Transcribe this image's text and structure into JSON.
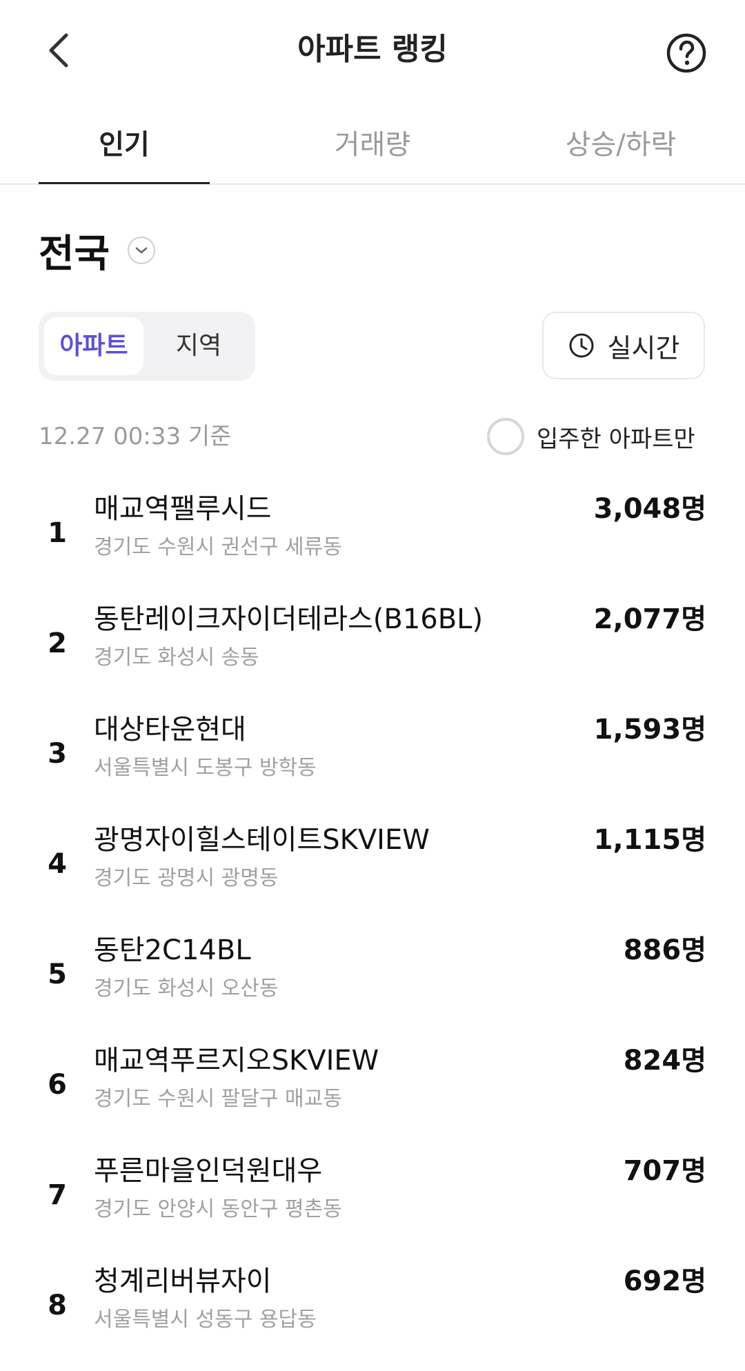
{
  "header": {
    "title": "아파트 랭킹",
    "back_icon": "chevron-left-icon",
    "help_icon": "question-circle-icon"
  },
  "tabs": [
    {
      "label": "인기",
      "active": true
    },
    {
      "label": "거래량",
      "active": false
    },
    {
      "label": "상승/하락",
      "active": false
    }
  ],
  "region": {
    "title": "전국",
    "chevron_icon": "chevron-down-icon"
  },
  "segment": {
    "options": [
      {
        "label": "아파트",
        "active": true
      },
      {
        "label": "지역",
        "active": false
      }
    ]
  },
  "realtime": {
    "label": "실시간",
    "icon": "clock-icon"
  },
  "timestamp": "12.27 00:33 기준",
  "filter": {
    "label": "입주한 아파트만",
    "checked": false
  },
  "colors": {
    "accent": "#5b50d6",
    "muted_text": "#9a9a9a",
    "primary_text": "#111111"
  },
  "rankings": [
    {
      "rank": "1",
      "name": "매교역팰루시드",
      "address": "경기도 수원시 권선구 세류동",
      "count": "3,048명"
    },
    {
      "rank": "2",
      "name": "동탄레이크자이더테라스(B16BL)",
      "address": "경기도 화성시 송동",
      "count": "2,077명"
    },
    {
      "rank": "3",
      "name": "대상타운현대",
      "address": "서울특별시 도봉구 방학동",
      "count": "1,593명"
    },
    {
      "rank": "4",
      "name": "광명자이힐스테이트SKVIEW",
      "address": "경기도 광명시 광명동",
      "count": "1,115명"
    },
    {
      "rank": "5",
      "name": "동탄2C14BL",
      "address": "경기도 화성시 오산동",
      "count": "886명"
    },
    {
      "rank": "6",
      "name": "매교역푸르지오SKVIEW",
      "address": "경기도 수원시 팔달구 매교동",
      "count": "824명"
    },
    {
      "rank": "7",
      "name": "푸른마을인덕원대우",
      "address": "경기도 안양시 동안구 평촌동",
      "count": "707명"
    },
    {
      "rank": "8",
      "name": "청계리버뷰자이",
      "address": "서울특별시 성동구 용답동",
      "count": "692명"
    }
  ]
}
